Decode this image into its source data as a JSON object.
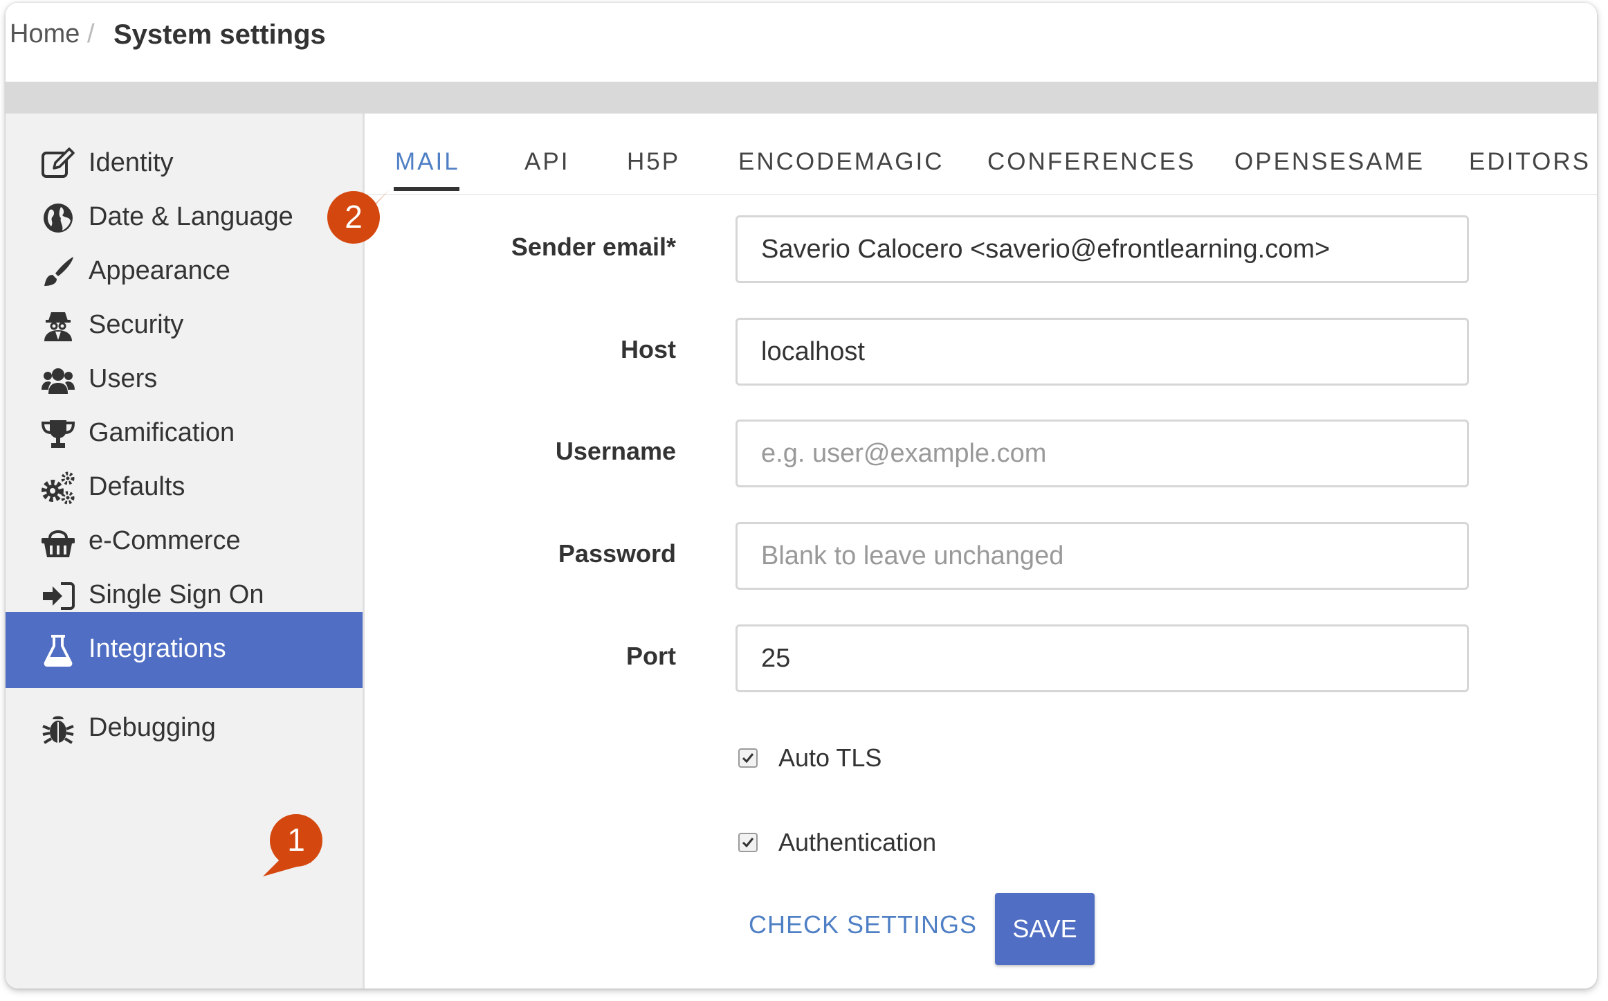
{
  "breadcrumb": {
    "home": "Home",
    "separator": "/",
    "current": "System settings"
  },
  "sidebar": {
    "items": [
      {
        "label": "Identity",
        "icon": "edit-icon"
      },
      {
        "label": "Date & Language",
        "icon": "globe-icon"
      },
      {
        "label": "Appearance",
        "icon": "brush-icon"
      },
      {
        "label": "Security",
        "icon": "user-secret-icon"
      },
      {
        "label": "Users",
        "icon": "users-icon"
      },
      {
        "label": "Gamification",
        "icon": "trophy-icon"
      },
      {
        "label": "Defaults",
        "icon": "gears-icon"
      },
      {
        "label": "e-Commerce",
        "icon": "basket-icon"
      },
      {
        "label": "Single Sign On",
        "icon": "sign-in-icon"
      },
      {
        "label": "Integrations",
        "icon": "flask-icon",
        "active": true
      },
      {
        "label": "Debugging",
        "icon": "bug-icon"
      }
    ]
  },
  "tabs": [
    {
      "label": "MAIL",
      "active": true
    },
    {
      "label": "API"
    },
    {
      "label": "H5P"
    },
    {
      "label": "ENCODEMAGIC"
    },
    {
      "label": "CONFERENCES"
    },
    {
      "label": "OPENSESAME"
    },
    {
      "label": "EDITORS"
    }
  ],
  "form": {
    "sender_email": {
      "label": "Sender email*",
      "value": "Saverio Calocero <saverio@efrontlearning.com>"
    },
    "host": {
      "label": "Host",
      "value": "localhost"
    },
    "username": {
      "label": "Username",
      "value": "",
      "placeholder": "e.g. user@example.com"
    },
    "password": {
      "label": "Password",
      "value": "",
      "placeholder": "Blank to leave unchanged"
    },
    "port": {
      "label": "Port",
      "value": "25"
    },
    "auto_tls": {
      "label": "Auto TLS",
      "checked": true
    },
    "authentication": {
      "label": "Authentication",
      "checked": true
    },
    "check_settings_label": "CHECK SETTINGS",
    "save_label": "SAVE"
  },
  "callouts": {
    "one": "1",
    "two": "2"
  },
  "colors": {
    "accent": "#4f6ec4",
    "link": "#4f7fc4",
    "callout": "#d4480f",
    "sidebar_bg": "#f1f1f1"
  }
}
